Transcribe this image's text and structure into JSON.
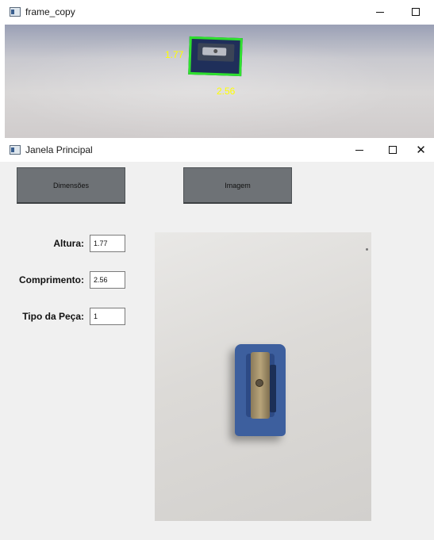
{
  "frame_copy": {
    "title": "frame_copy",
    "measure_height": "1.77",
    "measure_width": "2.56",
    "box_color": "#2fe02f",
    "label_color": "#ffff00"
  },
  "main_window": {
    "title": "Janela Principal",
    "buttons": {
      "dimensoes": "Dimensões",
      "imagem": "Imagem"
    },
    "fields": {
      "altura_label": "Altura:",
      "altura_value": "1.77",
      "comprimento_label": "Comprimento:",
      "comprimento_value": "2.56",
      "tipo_label": "Tipo da Peça:",
      "tipo_value": "1"
    }
  },
  "icons": {
    "app": "app-window-icon",
    "minimize": "minimize-icon",
    "maximize": "maximize-icon",
    "close": "close-icon"
  }
}
